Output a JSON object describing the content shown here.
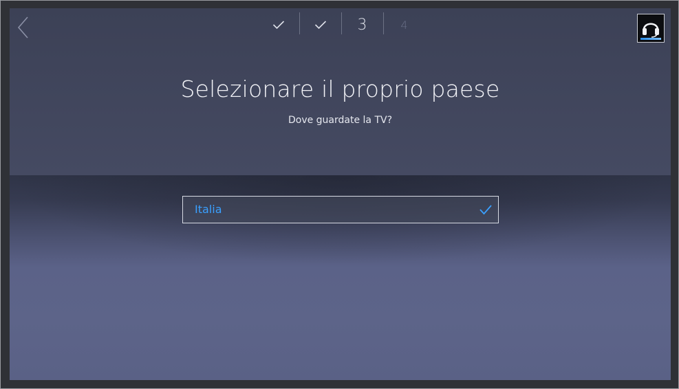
{
  "nav": {
    "back_icon": "chevron-left-icon"
  },
  "steps": [
    {
      "label": "",
      "status": "done",
      "icon": "check-icon"
    },
    {
      "label": "",
      "status": "done",
      "icon": "check-icon"
    },
    {
      "label": "3",
      "status": "current"
    },
    {
      "label": "4",
      "status": "pending"
    }
  ],
  "help": {
    "icon": "headset-icon"
  },
  "page": {
    "title": "Selezionare il proprio paese",
    "subtitle": "Dove guardate la TV?"
  },
  "country_select": {
    "value": "Italia",
    "selected_icon": "check-icon",
    "accent_color": "#3aa0ff"
  }
}
